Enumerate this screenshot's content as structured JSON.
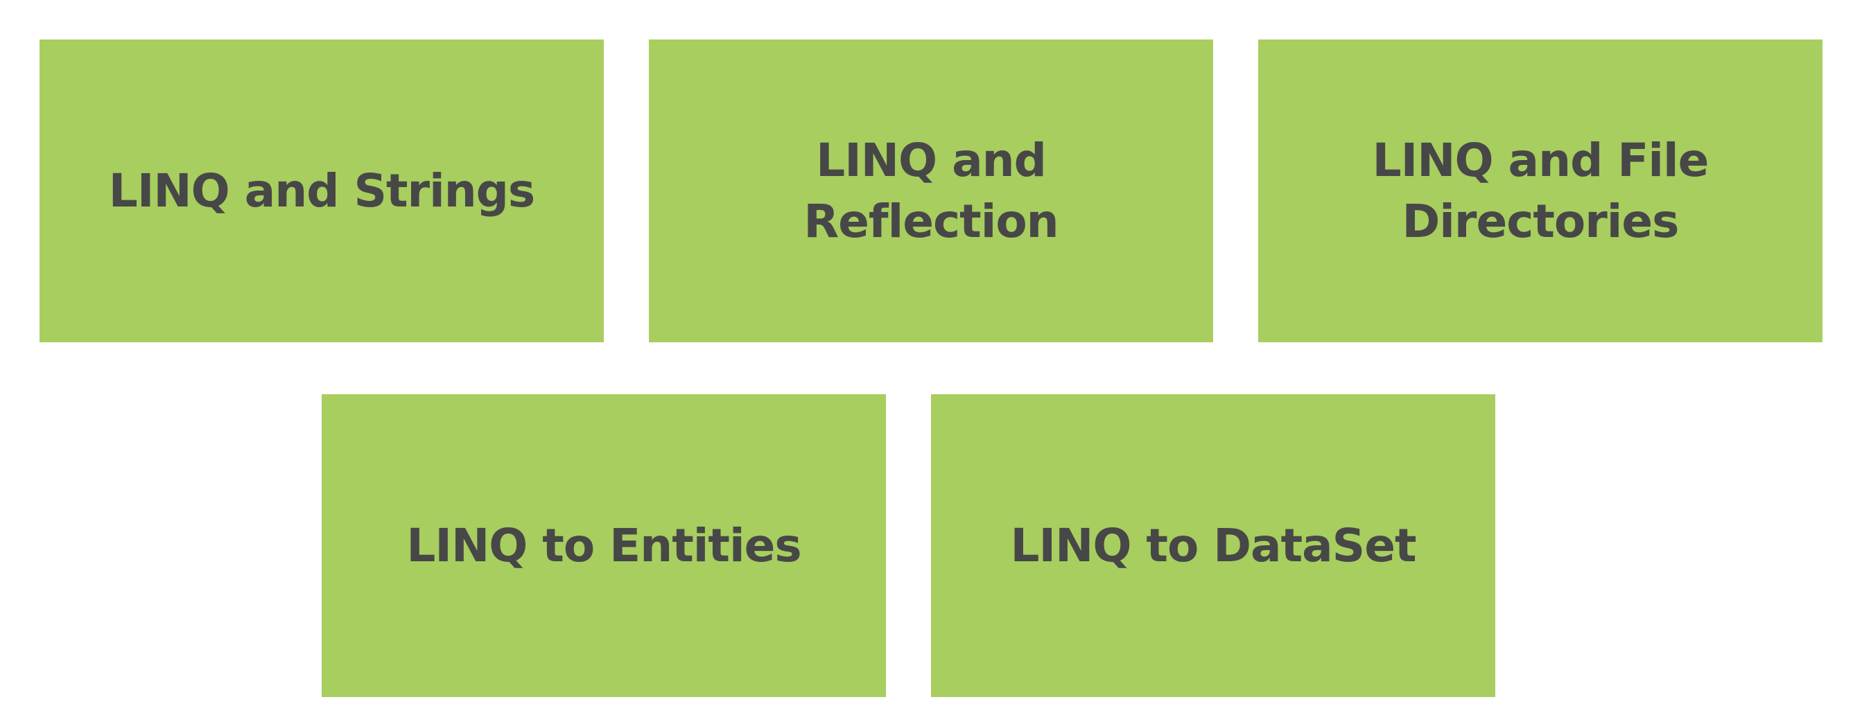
{
  "tiles": [
    {
      "label": "LINQ and Strings"
    },
    {
      "label": "LINQ and Reflection"
    },
    {
      "label": "LINQ and File Directories"
    },
    {
      "label": "LINQ to Entities"
    },
    {
      "label": "LINQ to DataSet"
    }
  ],
  "colors": {
    "tile_fill": "#a7ce5f",
    "text": "#474747",
    "background": "#ffffff"
  }
}
